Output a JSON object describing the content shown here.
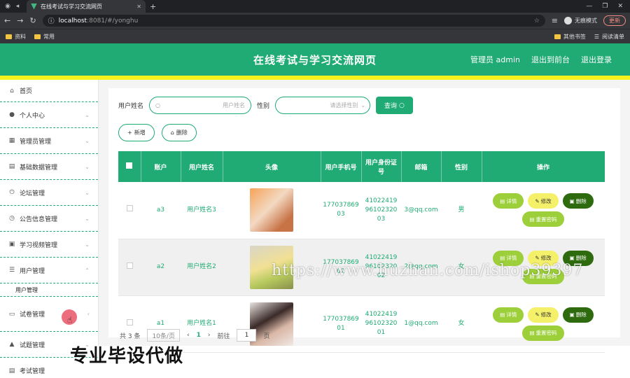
{
  "browser": {
    "tab_title": "在线考试与学习交流网页",
    "url_host": "localhost",
    "url_path": ":8081/#/yonghu",
    "incognito_label": "无痕模式",
    "update_label": "更新",
    "bookmarks": [
      "资料",
      "常用"
    ],
    "bookmarks_right": [
      "其他书签",
      "阅读清单"
    ]
  },
  "header": {
    "title": "在线考试与学习交流网页",
    "admin_label": "管理员 admin",
    "back_label": "退出到前台",
    "logout_label": "退出登录",
    "color": "#1fab73"
  },
  "sidebar": {
    "items": [
      {
        "label": "首页",
        "icon": "home-icon"
      },
      {
        "label": "个人中心",
        "icon": "user-icon"
      },
      {
        "label": "管理员管理",
        "icon": "grid-icon"
      },
      {
        "label": "基础数据管理",
        "icon": "clipboard-icon"
      },
      {
        "label": "论坛管理",
        "icon": "power-icon"
      },
      {
        "label": "公告信息管理",
        "icon": "clock-icon"
      },
      {
        "label": "学习视频管理",
        "icon": "video-icon"
      },
      {
        "label": "用户管理",
        "icon": "menu-icon"
      },
      {
        "label": "试卷管理",
        "icon": "chat-icon"
      },
      {
        "label": "试题管理",
        "icon": "thumb-icon"
      },
      {
        "label": "考试管理",
        "icon": "clipboard-icon"
      }
    ],
    "sub_item": "用户管理"
  },
  "search": {
    "name_label": "用户姓名",
    "name_placeholder": "用户姓名",
    "gender_label": "性别",
    "gender_placeholder": "请选择性别",
    "query_label": "查询"
  },
  "actions": {
    "add": "新增",
    "delete": "删除"
  },
  "table": {
    "headers": [
      "账户",
      "用户姓名",
      "头像",
      "用户手机号",
      "用户身份证号",
      "邮箱",
      "性别",
      "操作"
    ],
    "rows": [
      {
        "account": "a3",
        "name": "用户姓名3",
        "phone": "17703786903",
        "idcard": "410224199610232003",
        "email": "3@qq.com",
        "gender": "男"
      },
      {
        "account": "a2",
        "name": "用户姓名2",
        "phone": "17703786902",
        "idcard": "410224199610232002",
        "email": "2@qq.com",
        "gender": "女"
      },
      {
        "account": "a1",
        "name": "用户姓名1",
        "phone": "17703786901",
        "idcard": "410224199610232001",
        "email": "1@qq.com",
        "gender": "女"
      }
    ],
    "op_detail": "详情",
    "op_edit": "修改",
    "op_delete": "删除",
    "op_reset": "重置密码"
  },
  "pager": {
    "total": "共 3 条",
    "page_size": "10条/页",
    "current": "1",
    "goto_label": "前往",
    "goto_value": "1",
    "page_unit": "页"
  },
  "overlay": {
    "promo": "专业毕设代做",
    "watermark": "https://www.huzhan.com/ishop39397"
  }
}
